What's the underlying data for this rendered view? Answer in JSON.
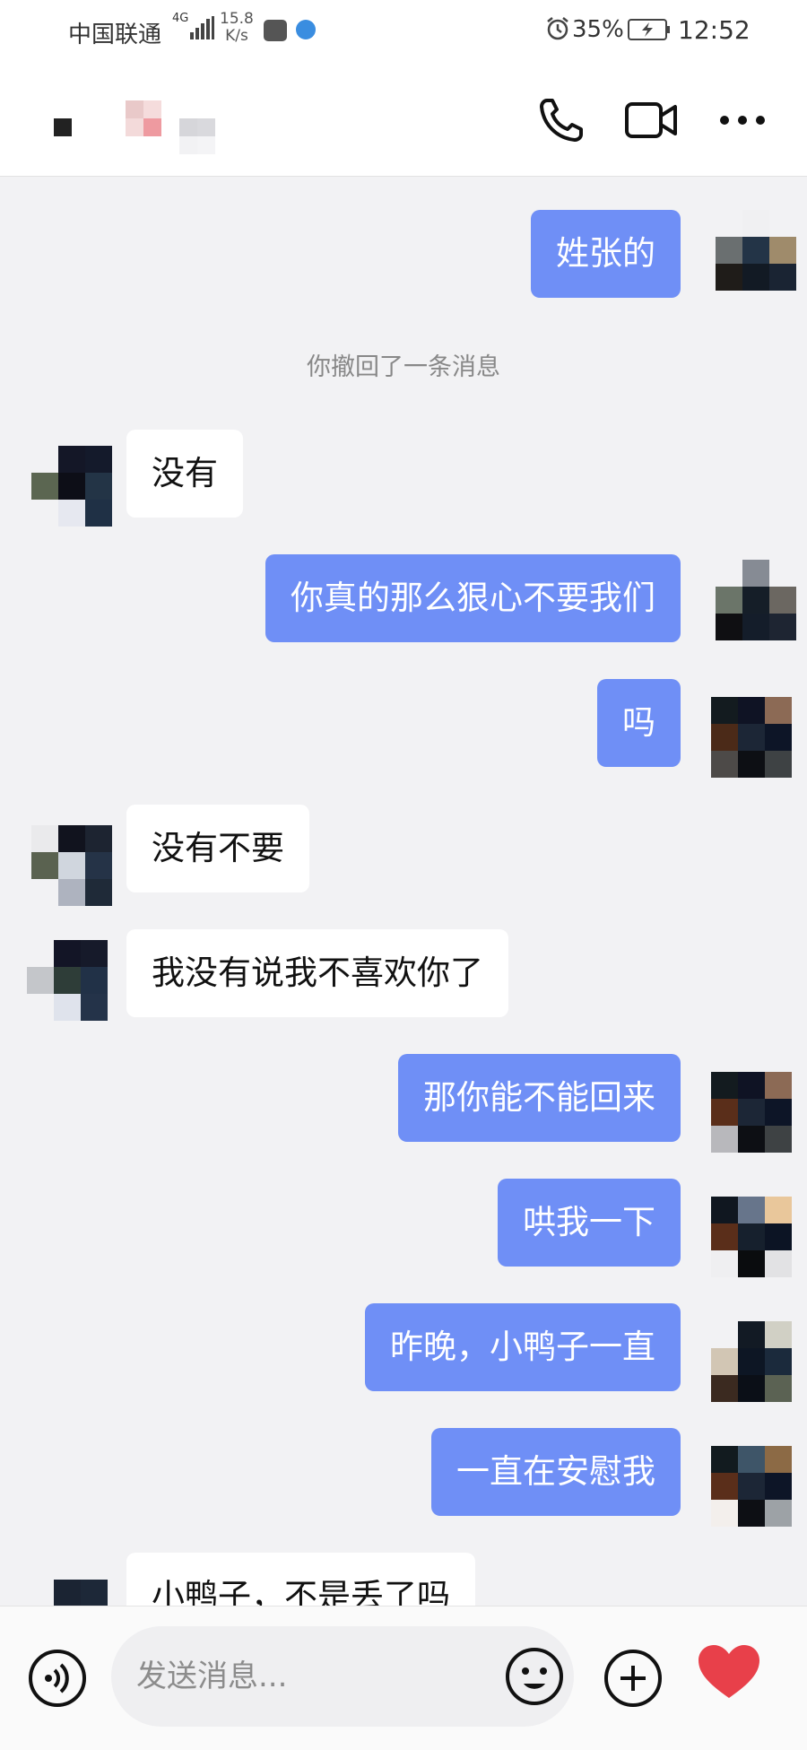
{
  "status_bar": {
    "carrier": "中国联通",
    "network_type": "4G",
    "speed_value": "15.8",
    "speed_unit": "K/s",
    "battery_percent": "35%",
    "time": "12:52"
  },
  "header": {
    "back_icon": "back-icon",
    "call_icon": "phone-icon",
    "video_icon": "video-icon",
    "more_icon": "more-icon"
  },
  "messages": [
    {
      "side": "out",
      "text": "姓张的"
    },
    {
      "side": "system",
      "text": "你撤回了一条消息"
    },
    {
      "side": "in",
      "text": "没有"
    },
    {
      "side": "out",
      "text": "你真的那么狠心不要我们"
    },
    {
      "side": "out",
      "text": "吗"
    },
    {
      "side": "in",
      "text": "没有不要"
    },
    {
      "side": "in",
      "text": "我没有说我不喜欢你了"
    },
    {
      "side": "out",
      "text": "那你能不能回来"
    },
    {
      "side": "out",
      "text": "哄我一下"
    },
    {
      "side": "out",
      "text": "昨晚，小鸭子一直"
    },
    {
      "side": "out",
      "text": "一直在安慰我"
    },
    {
      "side": "in",
      "text": "小鸭子，不是丢了吗"
    }
  ],
  "input_bar": {
    "placeholder": "发送消息...",
    "voice_icon": "voice-icon",
    "emoji_icon": "emoji-icon",
    "plus_icon": "plus-icon",
    "heart_icon": "heart-icon"
  },
  "colors": {
    "outgoing_bubble": "#6f8ff6",
    "incoming_bubble": "#ffffff",
    "background": "#f2f2f4"
  }
}
